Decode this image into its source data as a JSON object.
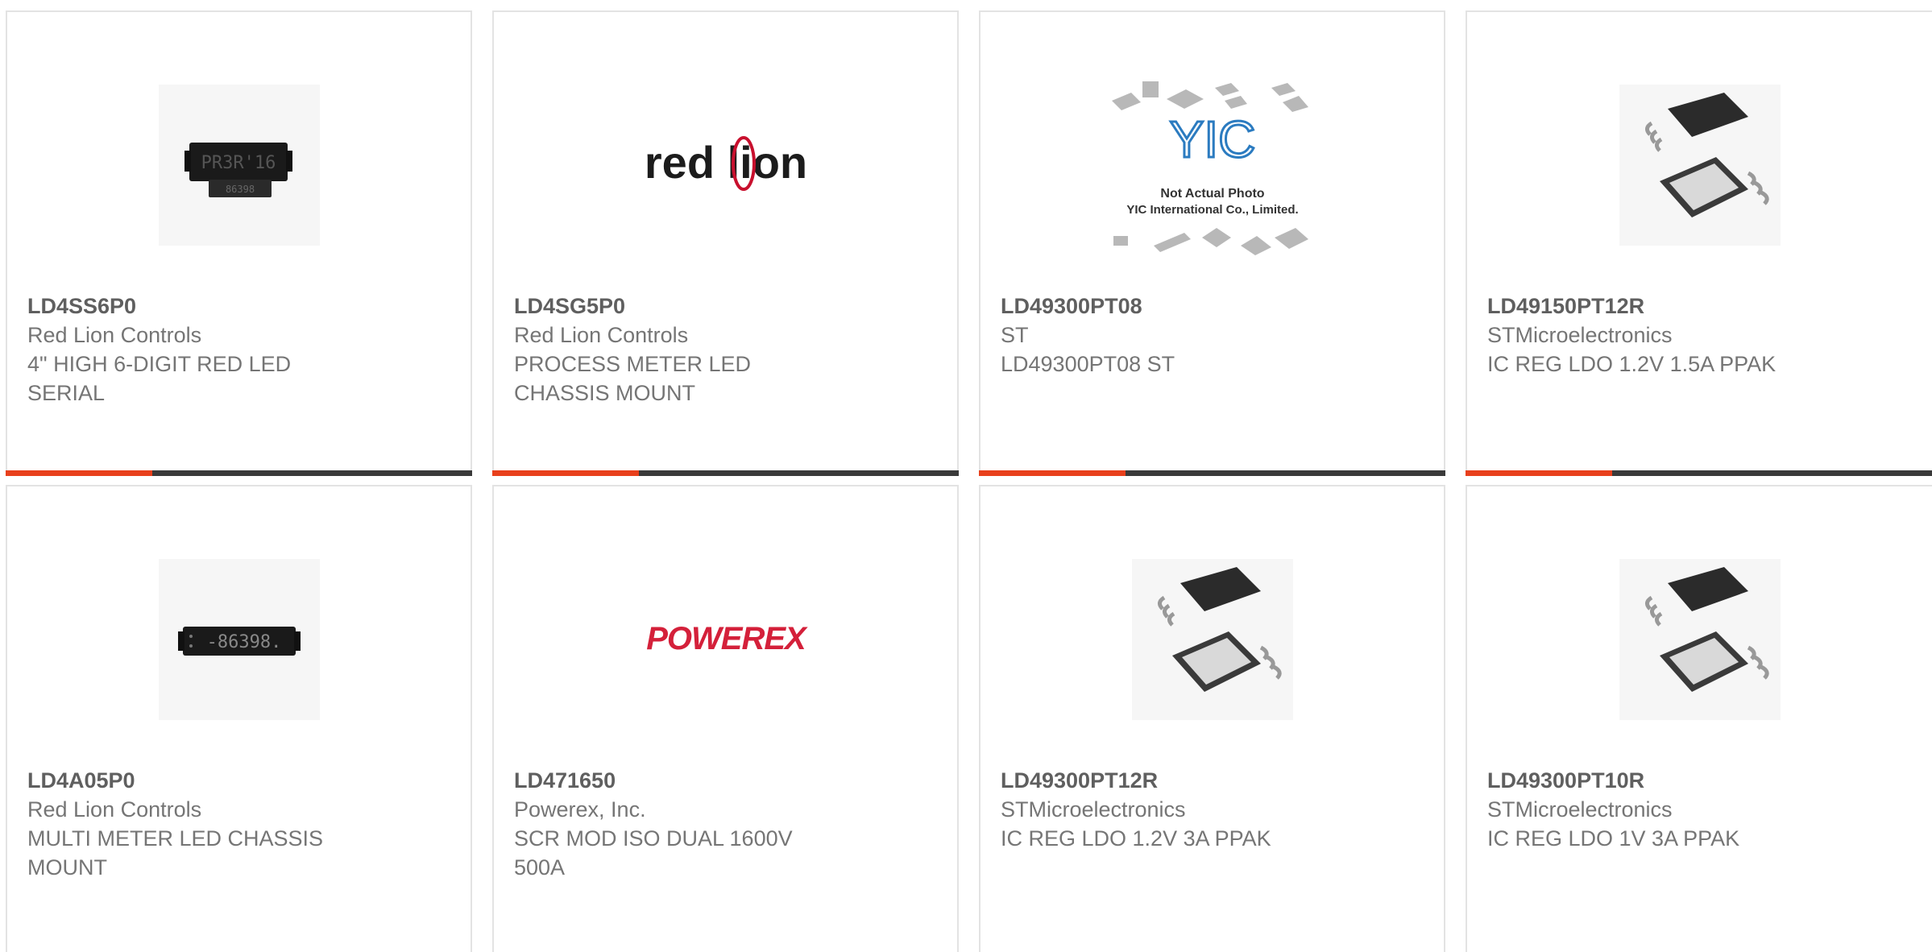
{
  "products": [
    {
      "part": "LD4SS6P0",
      "manufacturer": "Red Lion Controls",
      "description": "4\" HIGH 6-DIGIT RED LED SERIAL",
      "image": "led-display-icon"
    },
    {
      "part": "LD4SG5P0",
      "manufacturer": "Red Lion Controls",
      "description": "PROCESS METER LED CHASSIS MOUNT",
      "image": "red-lion-logo"
    },
    {
      "part": "LD49300PT08",
      "manufacturer": "ST",
      "description": "LD49300PT08 ST",
      "image": "not-actual-photo-placeholder",
      "image_text": {
        "brand": "YIC",
        "line1": "Not Actual Photo",
        "line2": "YIC International Co., Limited."
      }
    },
    {
      "part": "LD49150PT12R",
      "manufacturer": "STMicroelectronics",
      "description": "IC REG LDO 1.2V 1.5A PPAK",
      "image": "ppak-chip-icon"
    },
    {
      "part": "LD4A05P0",
      "manufacturer": "Red Lion Controls",
      "description": "MULTI METER LED CHASSIS MOUNT",
      "image": "led-display-icon"
    },
    {
      "part": "LD471650",
      "manufacturer": "Powerex, Inc.",
      "description": "SCR MOD ISO DUAL 1600V 500A",
      "image": "powerex-logo"
    },
    {
      "part": "LD49300PT12R",
      "manufacturer": "STMicroelectronics",
      "description": "IC REG LDO 1.2V 3A PPAK",
      "image": "ppak-chip-icon"
    },
    {
      "part": "LD49300PT10R",
      "manufacturer": "STMicroelectronics",
      "description": "IC REG LDO 1V 3A PPAK",
      "image": "ppak-chip-icon"
    }
  ],
  "logos": {
    "red_lion": "red lion",
    "powerex": "POWEREX"
  },
  "display_text": {
    "led1_top": "PR3R'16",
    "led1_bottom": "86398",
    "led2": "-86398."
  },
  "colors": {
    "accent": "#e8401c",
    "bar_dark": "#3a3a3a",
    "card_border": "#e3e3e3",
    "logo_red": "#c8102e"
  }
}
